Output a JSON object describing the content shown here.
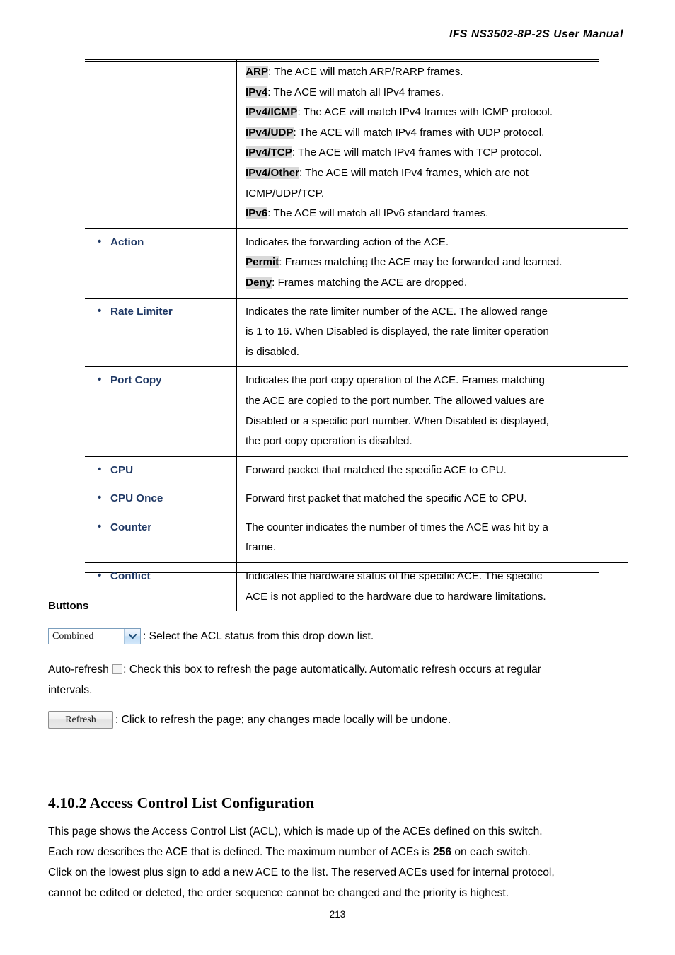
{
  "header": {
    "title": "IFS  NS3502-8P-2S  User  Manual"
  },
  "table": {
    "rows": [
      {
        "label": "",
        "lines": [
          {
            "kw": "ARP",
            "text": ": The ACE will match ARP/RARP frames."
          },
          {
            "kw": "IPv4",
            "text": ": The ACE will match all IPv4 frames."
          },
          {
            "kw": "IPv4/ICMP",
            "text": ": The ACE will match IPv4 frames with ICMP protocol."
          },
          {
            "kw": "IPv4/UDP",
            "text": ": The ACE will match IPv4 frames with UDP protocol."
          },
          {
            "kw": "IPv4/TCP",
            "text": ": The ACE will match IPv4 frames with TCP protocol."
          },
          {
            "kw": "IPv4/Other",
            "text": ": The ACE will match IPv4 frames, which are not"
          },
          {
            "kw": "",
            "text": "ICMP/UDP/TCP."
          },
          {
            "kw": "IPv6",
            "text": ": The ACE will match all IPv6 standard frames."
          }
        ]
      },
      {
        "label": "Action",
        "lines": [
          {
            "kw": "",
            "text": "Indicates the forwarding action of the ACE."
          },
          {
            "kw": "Permit",
            "text": ": Frames matching the ACE may be forwarded and learned."
          },
          {
            "kw": "Deny",
            "text": ": Frames matching the ACE are dropped."
          }
        ]
      },
      {
        "label": "Rate Limiter",
        "lines": [
          {
            "kw": "",
            "text": "Indicates the rate limiter number of the ACE. The allowed range"
          },
          {
            "kw": "",
            "text": "is 1 to 16. When Disabled is displayed, the rate limiter operation"
          },
          {
            "kw": "",
            "text": "is disabled."
          }
        ]
      },
      {
        "label": "Port Copy",
        "lines": [
          {
            "kw": "",
            "text": "Indicates the port copy operation of the ACE. Frames matching"
          },
          {
            "kw": "",
            "text": "the ACE are copied to the port number. The allowed values are"
          },
          {
            "kw": "",
            "text": "Disabled or a specific port number. When Disabled is displayed,"
          },
          {
            "kw": "",
            "text": "the port copy operation is disabled."
          }
        ]
      },
      {
        "label": "CPU",
        "lines": [
          {
            "kw": "",
            "text": "Forward packet that matched the specific ACE to CPU."
          }
        ]
      },
      {
        "label": "CPU Once",
        "lines": [
          {
            "kw": "",
            "text": "Forward first packet that matched the specific ACE to CPU."
          }
        ]
      },
      {
        "label": "Counter",
        "lines": [
          {
            "kw": "",
            "text": "The counter indicates the number of times the ACE was hit by a"
          },
          {
            "kw": "",
            "text": "frame."
          }
        ]
      },
      {
        "label": "Conflict",
        "lines": [
          {
            "kw": "",
            "text": "Indicates the hardware status of the specific ACE. The specific"
          },
          {
            "kw": "",
            "text": "ACE is not applied to the hardware due to hardware limitations."
          }
        ]
      }
    ]
  },
  "buttons_section": {
    "heading": "Buttons",
    "acl_select": {
      "value": "Combined",
      "description": ": Select the ACL status from this drop down list."
    },
    "auto_refresh": {
      "label": "Auto-refresh",
      "line1": ": Check this box to refresh the page automatically. Automatic refresh occurs at regular",
      "line2": "intervals."
    },
    "refresh_button": {
      "label": "Refresh",
      "description": ": Click to refresh the page; any changes made locally will be undone."
    }
  },
  "section": {
    "heading": "4.10.2 Access Control List Configuration",
    "paragraph": {
      "line1": "This page shows the Access Control List (ACL), which is made up of the ACEs defined on this switch.",
      "line2a": "Each row describes the ACE that is defined. The maximum number of ACEs is ",
      "line2b": "256",
      "line2c": " on each switch.",
      "line3": "Click on the lowest plus sign to add a new ACE to the list. The reserved ACEs used for internal protocol,",
      "line4": "cannot be edited or deleted, the order sequence cannot be changed and the priority is highest."
    }
  },
  "footer": {
    "page_number": "213"
  }
}
